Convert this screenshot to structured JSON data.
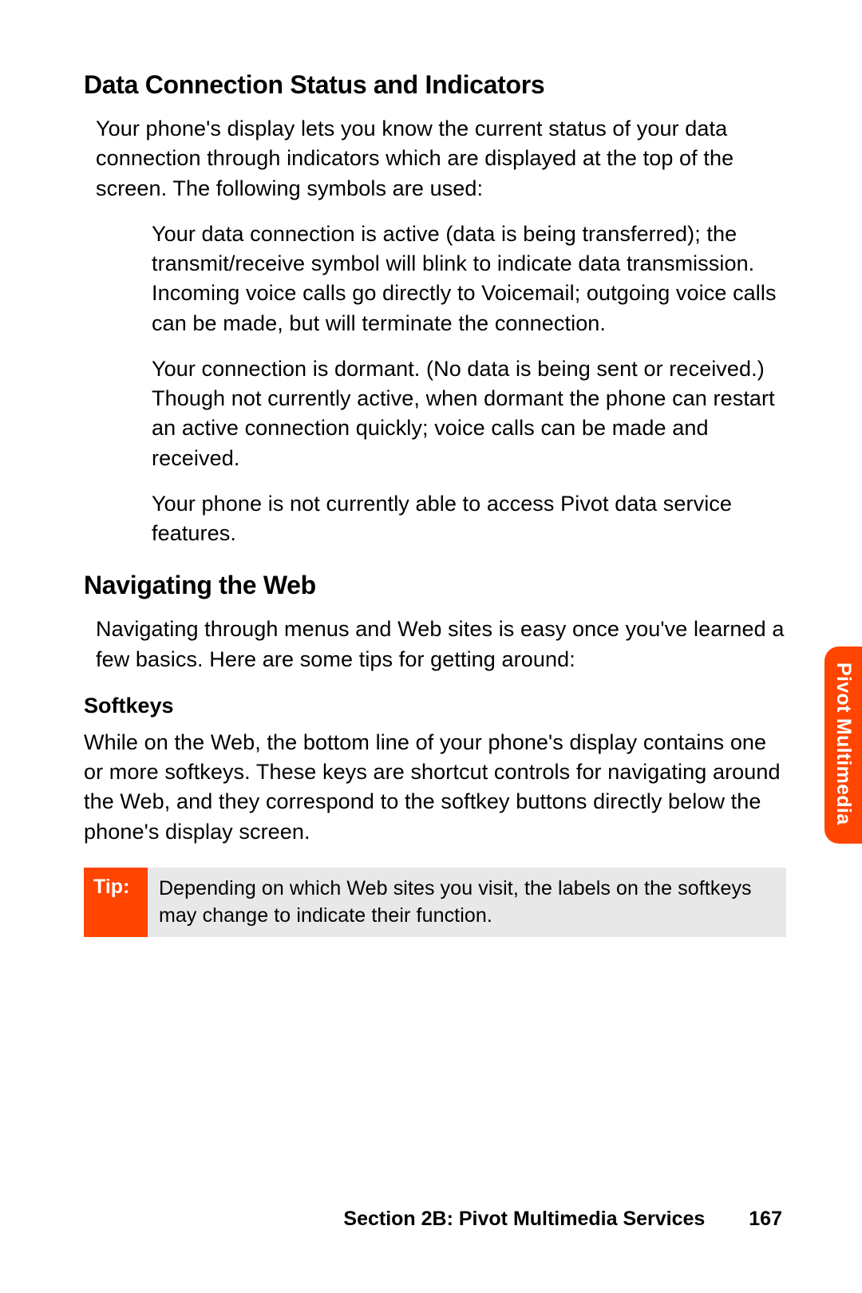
{
  "headings": {
    "h1": "Data Connection Status and Indicators",
    "h2": "Navigating the Web",
    "h3": "Softkeys"
  },
  "paragraphs": {
    "intro": "Your phone's display lets you know the current status of your data connection through indicators which are displayed at the top of the screen. The following symbols are used:",
    "indicator1": "Your data connection is active (data is being transferred); the transmit/receive symbol will blink to indicate data transmission. Incoming voice calls go directly to Voicemail; outgoing voice calls can be made, but will terminate the connection.",
    "indicator2": "Your connection is dormant. (No data is being sent or received.) Though not currently active, when dormant the phone can restart an active connection quickly; voice calls can be made and received.",
    "indicator3": "Your phone is not currently able to access Pivot data service features.",
    "navigating": "Navigating through menus and Web sites is easy once you've learned a few basics. Here are some tips for getting around:",
    "softkeys": "While on the Web, the bottom line of your phone's display contains one or more softkeys. These keys are shortcut controls for navigating around the Web, and they correspond to the softkey buttons directly below the phone's display screen."
  },
  "tip": {
    "label": "Tip:",
    "body": "Depending on which Web sites you visit, the labels on the softkeys may change to indicate their function."
  },
  "sideTab": "Pivot Multimedia",
  "footer": {
    "section": "Section 2B: Pivot Multimedia Services",
    "page": "167"
  }
}
